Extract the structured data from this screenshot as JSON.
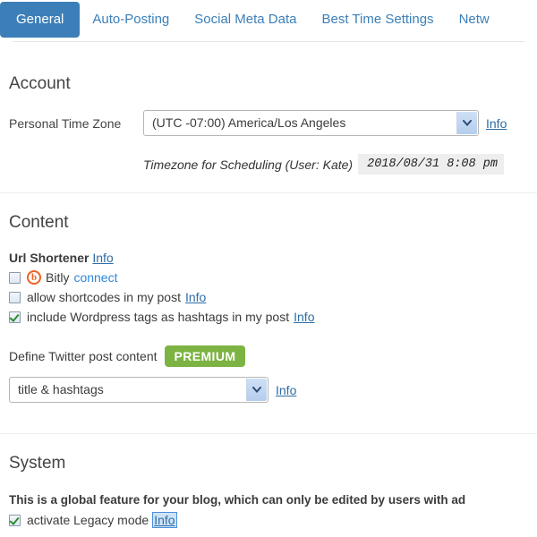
{
  "tabs": [
    {
      "label": "General",
      "active": true
    },
    {
      "label": "Auto-Posting",
      "active": false
    },
    {
      "label": "Social Meta Data",
      "active": false
    },
    {
      "label": "Best Time Settings",
      "active": false
    },
    {
      "label": "Netw",
      "active": false
    }
  ],
  "account": {
    "heading": "Account",
    "timezone_label": "Personal Time Zone",
    "timezone_value": "(UTC -07:00) America/Los Angeles",
    "timezone_info_label": "Info",
    "schedule_label": "Timezone for Scheduling (User: Kate)",
    "schedule_value": "2018/08/31 8:08 pm"
  },
  "content": {
    "heading": "Content",
    "url_shortener_label": "Url Shortener",
    "url_shortener_info_label": "Info",
    "bitly_label": "Bitly",
    "bitly_connect_label": "connect",
    "bitly_checked": false,
    "shortcodes_label": "allow shortcodes in my post",
    "shortcodes_info_label": "Info",
    "shortcodes_checked": false,
    "wptags_label": "include Wordpress tags as hashtags in my post",
    "wptags_info_label": "Info",
    "wptags_checked": true,
    "define_label": "Define Twitter post content",
    "premium_badge": "PREMIUM",
    "post_content_value": "title & hashtags",
    "post_content_info_label": "Info"
  },
  "system": {
    "heading": "System",
    "note": "This is a global feature for your blog, which can only be edited by users with ad",
    "legacy_label": "activate Legacy mode",
    "legacy_info_label": "Info",
    "legacy_checked": true
  },
  "colors": {
    "accent_blue": "#3c7fb8",
    "link_blue": "#2e6da4",
    "premium_green": "#7cb342",
    "bitly_orange": "#ee6123",
    "check_green": "#2e8b2e"
  }
}
